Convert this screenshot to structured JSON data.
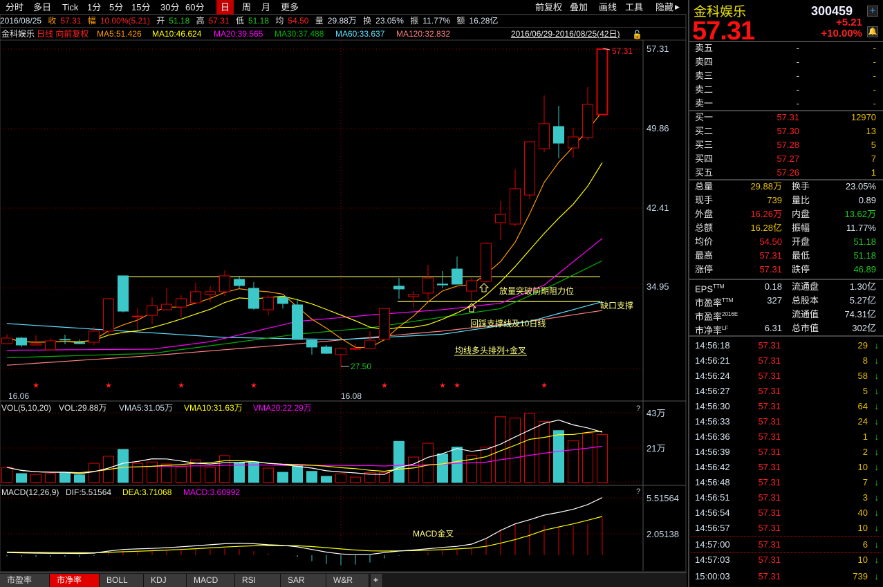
{
  "toolbar": {
    "periods": [
      "分时",
      "多日",
      "Tick",
      "1分",
      "5分",
      "15分",
      "30分",
      "60分",
      "日",
      "周",
      "月",
      "更多"
    ],
    "active_period": "日",
    "right_items": [
      "前复权",
      "叠加",
      "画线",
      "工具",
      "隐藏"
    ]
  },
  "infobar": {
    "date": "2016/08/25",
    "close_label": "收",
    "close": "57.31",
    "change_label": "幅",
    "change": "10.00%(5.21)",
    "open_label": "开",
    "open": "51.18",
    "high_label": "高",
    "high": "57.31",
    "low_label": "低",
    "low": "51.18",
    "avg_label": "均",
    "avg": "54.50",
    "vol_label": "量",
    "vol": "29.88万",
    "turnover_label": "换",
    "turnover": "23.05%",
    "amp_label": "振",
    "amp": "11.77%",
    "amount_label": "额",
    "amount": "16.28亿"
  },
  "legend": {
    "name": "金科娱乐",
    "mode": "日线 向前复权",
    "ma5": "MA5:51.426",
    "ma10": "MA10:46.624",
    "ma20": "MA20:39.565",
    "ma30": "MA30:37.488",
    "ma60": "MA60:33.637",
    "ma120": "MA120:32.832",
    "range": "2016/06/29-2016/08/25(42日)"
  },
  "price_axis": [
    "57.31",
    "49.86",
    "42.41",
    "34.95"
  ],
  "date_axis": [
    "16.06",
    "16.08"
  ],
  "last_price_label": "57.31",
  "low_price_label": "27.50",
  "annotations": {
    "breakout": "放量突破前期阻力位",
    "gap": "缺口支撑",
    "pullback": "回踩支撑线及10日线",
    "ma_bull": "均线多头排列+金叉",
    "macd_cross": "MACD金叉"
  },
  "vol_panel": {
    "title": "VOL(5,10,20)",
    "vol": "VOL:29.88万",
    "vma5": "VMA5:31.05万",
    "vma10": "VMA10:31.63万",
    "vma20": "VMA20:22.29万",
    "axis": [
      "43万",
      "21万"
    ],
    "help": "?"
  },
  "macd_panel": {
    "title": "MACD(12,26,9)",
    "dif": "DIF:5.51564",
    "dea": "DEA:3.71068",
    "macd": "MACD:3.60992",
    "axis": [
      "5.51564",
      "2.05138"
    ],
    "help": "?"
  },
  "colors": {
    "up": "#e00000",
    "down": "#3cc8c8",
    "ma5": "#ff9900",
    "ma10": "#ffff00",
    "ma20": "#ff00ff",
    "ma30": "#00b000",
    "ma60": "#60e0ff",
    "ma120": "#ff8080"
  },
  "chart_data": {
    "type": "candlestick",
    "candles": [
      [
        29.72,
        30.63,
        29.72,
        30.24
      ],
      [
        30.24,
        30.37,
        29.4,
        29.59
      ],
      [
        29.59,
        30.5,
        29.59,
        29.72
      ],
      [
        29.14,
        30.24,
        29.14,
        29.98
      ],
      [
        30.12,
        30.56,
        29.66,
        30.08
      ],
      [
        29.8,
        30.1,
        29.66,
        29.72
      ],
      [
        29.85,
        31.27,
        29.59,
        30.89
      ],
      [
        30.89,
        33.93,
        30.63,
        33.93
      ],
      [
        36.07,
        36.07,
        32.64,
        32.76
      ],
      [
        32.25,
        33.09,
        30.95,
        32.3
      ],
      [
        32.37,
        34.06,
        31.53,
        33.28
      ],
      [
        32.89,
        34.9,
        32.83,
        33.41
      ],
      [
        33.15,
        34.25,
        32.18,
        33.93
      ],
      [
        33.54,
        35.42,
        33.54,
        34.58
      ],
      [
        34.32,
        35.1,
        33.6,
        34.58
      ],
      [
        34.58,
        36.58,
        34.19,
        36.07
      ],
      [
        35.74,
        36.07,
        34.84,
        35.16
      ],
      [
        34.9,
        35.48,
        32.89,
        33.02
      ],
      [
        32.89,
        34.25,
        32.37,
        34.06
      ],
      [
        34.06,
        34.1,
        33.0,
        33.48
      ],
      [
        33.35,
        33.93,
        30.11,
        30.11
      ],
      [
        30.04,
        30.04,
        28.68,
        29.4
      ],
      [
        29.4,
        29.59,
        28.75,
        28.81
      ],
      [
        28.68,
        29.27,
        27.5,
        29.27
      ],
      [
        29.2,
        29.72,
        29.07,
        29.27
      ],
      [
        29.27,
        30.89,
        29.27,
        30.04
      ],
      [
        30.11,
        33.02,
        29.98,
        33.02
      ],
      [
        35.1,
        35.87,
        33.93,
        34.84
      ],
      [
        34.13,
        34.64,
        33.09,
        34.32
      ],
      [
        34.45,
        37.1,
        33.86,
        35.87
      ],
      [
        35.3,
        36.52,
        34.9,
        35.22
      ],
      [
        36.71,
        37.88,
        35.29,
        35.29
      ],
      [
        34.64,
        35.87,
        33.8,
        35.61
      ],
      [
        35.55,
        39.11,
        35.4,
        39.11
      ],
      [
        41.05,
        43.06,
        39.43,
        41.83
      ],
      [
        40.92,
        46.04,
        40.73,
        44.23
      ],
      [
        43.64,
        48.63,
        43.26,
        48.63
      ],
      [
        47.98,
        52.97,
        47.66,
        50.32
      ],
      [
        50.06,
        52.0,
        47.08,
        48.5
      ],
      [
        48.05,
        49.93,
        47.14,
        49.08
      ],
      [
        49.02,
        53.75,
        48.76,
        52.13
      ],
      [
        51.18,
        57.31,
        51.18,
        57.31
      ]
    ],
    "volume_wan": [
      9.4,
      5.5,
      5.0,
      5.5,
      6.2,
      4.7,
      11.9,
      16.3,
      20.6,
      11.9,
      12.7,
      11.5,
      9.8,
      14.0,
      9.4,
      16.7,
      12.2,
      12.2,
      8.9,
      6.3,
      10.3,
      6.9,
      3.8,
      5.3,
      3.3,
      6.2,
      6.2,
      25.6,
      15.8,
      24.4,
      17.7,
      22.0,
      16.8,
      22.0,
      40.9,
      40.1,
      43.1,
      37.9,
      32.3,
      25.9,
      30.6,
      29.88
    ],
    "ma_anchors": {
      "ma20": [
        [
          0,
          29.1
        ],
        [
          10,
          29.2
        ],
        [
          14,
          29.9
        ],
        [
          20,
          31.8
        ],
        [
          25,
          32.4
        ],
        [
          30,
          32.9
        ],
        [
          34,
          33.5
        ],
        [
          37,
          35.2
        ],
        [
          41,
          39.57
        ]
      ],
      "ma30": [
        [
          0,
          28.4
        ],
        [
          10,
          28.8
        ],
        [
          20,
          30.6
        ],
        [
          25,
          31.2
        ],
        [
          30,
          32.2
        ],
        [
          34,
          33.0
        ],
        [
          37,
          34.8
        ],
        [
          41,
          37.49
        ]
      ],
      "ma60": [
        [
          0,
          31.6
        ],
        [
          8,
          30.9
        ],
        [
          15,
          30.3
        ],
        [
          23,
          30.1
        ],
        [
          30,
          30.6
        ],
        [
          36,
          31.8
        ],
        [
          41,
          33.64
        ]
      ],
      "ma120": [
        [
          0,
          27.7
        ],
        [
          10,
          28.6
        ],
        [
          20,
          29.7
        ],
        [
          30,
          30.9
        ],
        [
          36,
          31.8
        ],
        [
          41,
          32.83
        ]
      ]
    },
    "dif": [
      0.25,
      0.22,
      0.2,
      0.18,
      0.18,
      0.16,
      0.2,
      0.4,
      0.55,
      0.6,
      0.65,
      0.72,
      0.8,
      0.9,
      1.0,
      1.1,
      1.15,
      1.1,
      1.0,
      0.95,
      0.8,
      0.55,
      0.3,
      0.12,
      0.05,
      0.07,
      0.25,
      0.4,
      0.5,
      0.62,
      0.75,
      0.85,
      1.06,
      1.6,
      2.38,
      3.0,
      3.4,
      3.84,
      4.1,
      4.4,
      4.85,
      5.51564
    ],
    "dea": [
      0.3,
      0.29,
      0.28,
      0.26,
      0.25,
      0.24,
      0.23,
      0.27,
      0.33,
      0.38,
      0.43,
      0.49,
      0.55,
      0.62,
      0.7,
      0.78,
      0.85,
      0.9,
      0.92,
      0.93,
      0.9,
      0.83,
      0.72,
      0.6,
      0.5,
      0.42,
      0.4,
      0.42,
      0.44,
      0.48,
      0.53,
      0.6,
      0.68,
      0.85,
      1.15,
      1.5,
      1.9,
      2.4,
      2.7,
      3.0,
      3.35,
      3.71068
    ],
    "price_range": [
      27.5,
      57.31
    ],
    "star_days": [
      2,
      7,
      12,
      17,
      26,
      30,
      31,
      37
    ],
    "resistance_level": 35.98,
    "gap_support_level": 33.67
  },
  "quote": {
    "name": "金科娱乐",
    "code": "300459",
    "price": "57.31",
    "change": "+5.21",
    "change_pct": "+10.00%",
    "asks": [
      {
        "label": "卖五",
        "price": "-",
        "vol": "-"
      },
      {
        "label": "卖四",
        "price": "-",
        "vol": "-"
      },
      {
        "label": "卖三",
        "price": "-",
        "vol": "-"
      },
      {
        "label": "卖二",
        "price": "-",
        "vol": "-"
      },
      {
        "label": "卖一",
        "price": "-",
        "vol": "-"
      }
    ],
    "bids": [
      {
        "label": "买一",
        "price": "57.31",
        "vol": "12970"
      },
      {
        "label": "买二",
        "price": "57.30",
        "vol": "13"
      },
      {
        "label": "买三",
        "price": "57.28",
        "vol": "5"
      },
      {
        "label": "买四",
        "price": "57.27",
        "vol": "7"
      },
      {
        "label": "买五",
        "price": "57.26",
        "vol": "1"
      }
    ],
    "stats": [
      {
        "l1": "总量",
        "v1": "29.88万",
        "c1": "yel",
        "l2": "换手",
        "v2": "23.05%",
        "c2": "wht"
      },
      {
        "l1": "现手",
        "v1": "739",
        "c1": "yel",
        "l2": "量比",
        "v2": "0.89",
        "c2": "wht"
      },
      {
        "l1": "外盘",
        "v1": "16.26万",
        "c1": "red",
        "l2": "内盘",
        "v2": "13.62万",
        "c2": "grn"
      },
      {
        "l1": "总额",
        "v1": "16.28亿",
        "c1": "yel",
        "l2": "振幅",
        "v2": "11.77%",
        "c2": "wht"
      },
      {
        "l1": "均价",
        "v1": "54.50",
        "c1": "red",
        "l2": "开盘",
        "v2": "51.18",
        "c2": "grn"
      },
      {
        "l1": "最高",
        "v1": "57.31",
        "c1": "red",
        "l2": "最低",
        "v2": "51.18",
        "c2": "grn"
      },
      {
        "l1": "涨停",
        "v1": "57.31",
        "c1": "red",
        "l2": "跌停",
        "v2": "46.89",
        "c2": "grn"
      }
    ],
    "fundamentals": [
      {
        "l1": "EPS",
        "s1": "TTM",
        "v1": "0.18",
        "l2": "流通盘",
        "v2": "1.30亿"
      },
      {
        "l1": "市盈率",
        "s1": "TTM",
        "v1": "327",
        "l2": "总股本",
        "v2": "5.27亿"
      },
      {
        "l1": "市盈率",
        "s1": "2016E",
        "v1": "",
        "l2": "流通值",
        "v2": "74.31亿"
      },
      {
        "l1": "市净率",
        "s1": "LF",
        "v1": "6.31",
        "l2": "总市值",
        "v2": "302亿"
      }
    ],
    "ticks": [
      {
        "time": "14:56:18",
        "price": "57.31",
        "vol": "29"
      },
      {
        "time": "14:56:21",
        "price": "57.31",
        "vol": "8"
      },
      {
        "time": "14:56:24",
        "price": "57.31",
        "vol": "58"
      },
      {
        "time": "14:56:27",
        "price": "57.31",
        "vol": "5"
      },
      {
        "time": "14:56:30",
        "price": "57.31",
        "vol": "64"
      },
      {
        "time": "14:56:33",
        "price": "57.31",
        "vol": "24"
      },
      {
        "time": "14:56:36",
        "price": "57.31",
        "vol": "1"
      },
      {
        "time": "14:56:39",
        "price": "57.31",
        "vol": "2"
      },
      {
        "time": "14:56:42",
        "price": "57.31",
        "vol": "10"
      },
      {
        "time": "14:56:48",
        "price": "57.31",
        "vol": "7"
      },
      {
        "time": "14:56:51",
        "price": "57.31",
        "vol": "3"
      },
      {
        "time": "14:56:54",
        "price": "57.31",
        "vol": "40"
      },
      {
        "time": "14:56:57",
        "price": "57.31",
        "vol": "10"
      },
      {
        "time": "14:57:00",
        "price": "57.31",
        "vol": "6"
      },
      {
        "time": "14:57:03",
        "price": "57.31",
        "vol": "10"
      },
      {
        "time": "15:00:03",
        "price": "57.31",
        "vol": "739"
      }
    ],
    "tick_arrow": "↓"
  },
  "tabs": [
    "市盈率",
    "市净率",
    "BOLL",
    "KDJ",
    "MACD",
    "RSI",
    "SAR",
    "W&R"
  ],
  "active_tab": "市净率",
  "add_tab": "+"
}
